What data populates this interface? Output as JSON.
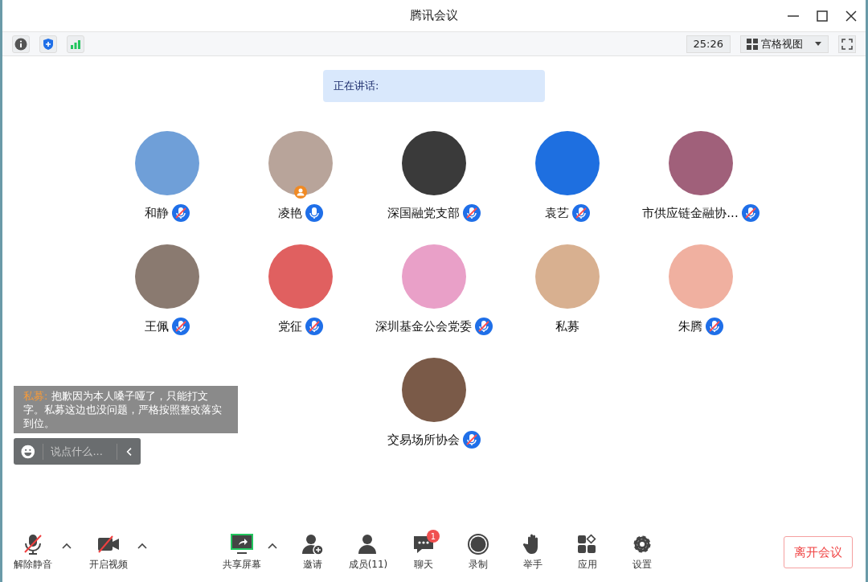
{
  "window": {
    "title": "腾讯会议"
  },
  "toolbar": {
    "timer": "25:26",
    "view_mode": "宫格视图"
  },
  "speaking": {
    "label": "正在讲话:"
  },
  "participants": [
    {
      "name": "和静",
      "mic_shown": true,
      "mic_muted": true,
      "host": false,
      "color": "#6f9fd8"
    },
    {
      "name": "凌艳",
      "mic_shown": true,
      "mic_muted": false,
      "host": true,
      "color": "#b8a49a"
    },
    {
      "name": "深国融党支部",
      "mic_shown": true,
      "mic_muted": true,
      "host": false,
      "color": "#3a3a3a"
    },
    {
      "name": "袁艺",
      "mic_shown": true,
      "mic_muted": true,
      "host": false,
      "color": "#1e6fe0"
    },
    {
      "name": "市供应链金融协...",
      "mic_shown": true,
      "mic_muted": true,
      "host": false,
      "color": "#a0607a"
    },
    {
      "name": "王佩",
      "mic_shown": true,
      "mic_muted": true,
      "host": false,
      "color": "#8a7a70"
    },
    {
      "name": "党征",
      "mic_shown": true,
      "mic_muted": true,
      "host": false,
      "color": "#e06060"
    },
    {
      "name": "深圳基金公会党委",
      "mic_shown": true,
      "mic_muted": true,
      "host": false,
      "color": "#e9a0c8"
    },
    {
      "name": "私募",
      "mic_shown": false,
      "host": false,
      "color": "#d8b090"
    },
    {
      "name": "朱腾",
      "mic_shown": true,
      "mic_muted": true,
      "host": false,
      "color": "#f0b0a0"
    },
    {
      "name": "交易场所协会",
      "mic_shown": true,
      "mic_muted": true,
      "host": false,
      "color": "#7a5a48"
    }
  ],
  "chat": {
    "sender": "私募:",
    "message": "抱歉因为本人嗓子哑了，只能打文字。私募这边也没问题，严格按照整改落实到位。",
    "input_placeholder": "说点什么..."
  },
  "controls": [
    {
      "kind": "mic",
      "label": "解除静音",
      "caret": true
    },
    {
      "kind": "video",
      "label": "开启视频",
      "caret": true
    },
    {
      "kind": "share",
      "label": "共享屏幕",
      "caret": true
    },
    {
      "kind": "invite",
      "label": "邀请",
      "caret": false
    },
    {
      "kind": "members",
      "label": "成员(11)",
      "caret": false
    },
    {
      "kind": "chat",
      "label": "聊天",
      "caret": false,
      "badge": "1"
    },
    {
      "kind": "record",
      "label": "录制",
      "caret": false
    },
    {
      "kind": "hand",
      "label": "举手",
      "caret": false
    },
    {
      "kind": "apps",
      "label": "应用",
      "caret": false
    },
    {
      "kind": "settings",
      "label": "设置",
      "caret": false
    }
  ],
  "leave_button": "离开会议"
}
